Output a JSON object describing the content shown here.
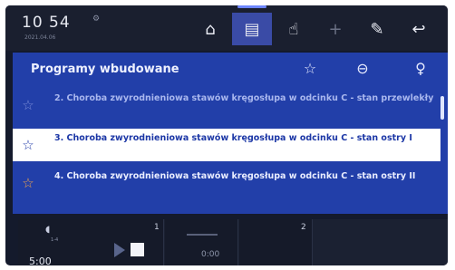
{
  "status": {
    "time": "10 54",
    "date": "2021.04.06"
  },
  "toolbar": {
    "icons": [
      "home-icon",
      "document-icon",
      "hand-icon",
      "plus-icon",
      "wrench-icon",
      "back-icon"
    ]
  },
  "dialog": {
    "title": "Programy wbudowane",
    "header_icons": [
      "star-outline-icon",
      "lock-key-icon",
      "user-icon"
    ],
    "items": [
      {
        "label": "2. Choroba zwyrodnieniowa stawów kręgosłupa w odcinku C - stan przewlekły",
        "favorite": false,
        "selected": false
      },
      {
        "label": "3. Choroba zwyrodnieniowa stawów kręgosłupa w odcinku C - stan ostry I",
        "favorite": false,
        "selected": true
      },
      {
        "label": "4. Choroba zwyrodnieniowa stawów kręgosłupa w odcinku C - stan ostry II",
        "favorite": true,
        "selected": false
      }
    ]
  },
  "bottom": {
    "cell1_number": "1",
    "cell2_number": "2",
    "main_time": "5:00",
    "cell1_time": "0:00",
    "speaker_label": "1-4"
  },
  "colors": {
    "dialog_bg": "#223fa9",
    "selected_bg": "#ffffff",
    "favorite_star": "#f2a64a"
  }
}
